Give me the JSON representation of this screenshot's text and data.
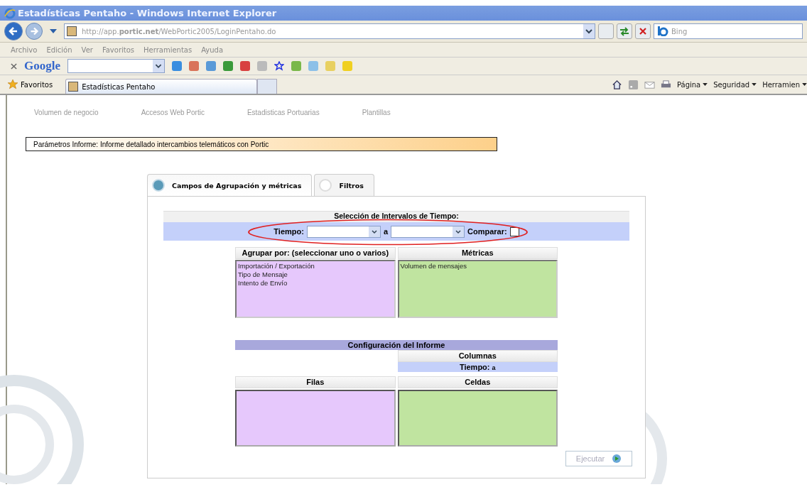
{
  "window": {
    "title": "Estadísticas Pentaho - Windows Internet Explorer"
  },
  "address_bar": {
    "url": "http://app.**portic.net**/WebPortic2005/LoginPentaho.do"
  },
  "search": {
    "placeholder": "Bing"
  },
  "menu": [
    "Archivo",
    "Edición",
    "Ver",
    "Favoritos",
    "Herramientas",
    "Ayuda"
  ],
  "google_toolbar": {
    "logo": "Google"
  },
  "favorites_bar": {
    "favorites": "Favoritos",
    "tabs": [
      {
        "label": "Estadísticas Pentaho",
        "selected": true
      }
    ],
    "commands": [
      "Página",
      "Seguridad",
      "Herramien"
    ]
  },
  "nav": [
    "Volumen de negocio",
    "Accesos Web Portic",
    "Estadisticas Portuarias",
    "Plantillas"
  ],
  "report_bar": "Parámetros Informe: Informe detallado intercambios telemáticos con Portic",
  "tabs": [
    {
      "label": "Campos de Agrupación y métricas",
      "selected": true
    },
    {
      "label": "Filtros",
      "selected": false
    }
  ],
  "time_section": {
    "title": "Selección de Intervalos de Tiempo:",
    "from_label": "Tiempo:",
    "to_label": "a",
    "compare_label": "Comparar:",
    "compare_checked": false
  },
  "group_by": {
    "header": "Agrupar por: (seleccionar uno o varios)",
    "items": [
      "Importación / Exportación",
      "Tipo de Mensaje",
      "Intento de Envío"
    ]
  },
  "metrics": {
    "header": "Métricas",
    "items": [
      "Volumen de mensajes"
    ]
  },
  "config": {
    "title": "Configuración del Informe",
    "columns_header": "Columnas",
    "columns_label": "Tiempo:",
    "columns_value": "a",
    "rows_header": "Filas",
    "cells_header": "Celdas"
  },
  "run_button": {
    "label": "Ejecutar",
    "disabled": true
  }
}
